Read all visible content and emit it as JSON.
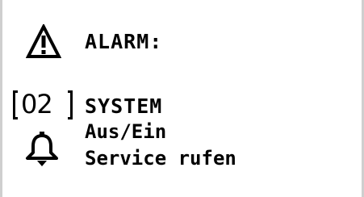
{
  "alarm": {
    "title": "ALARM:",
    "code": "02",
    "message_line1": "SYSTEM",
    "message_line2": "Aus/Ein",
    "message_line3": "Service rufen"
  },
  "icons": {
    "header": "warning-triangle-icon",
    "action": "bell-icon"
  },
  "colors": {
    "background": "#ffffff",
    "foreground": "#000000"
  }
}
